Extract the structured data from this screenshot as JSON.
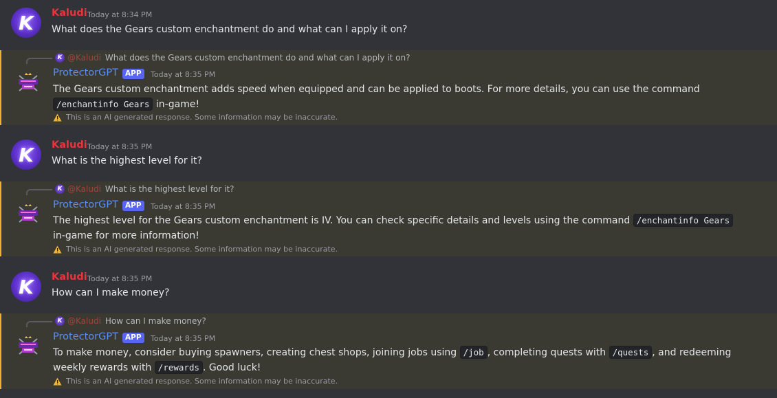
{
  "warning_text": "This is an AI generated response. Some information may be inaccurate.",
  "messages": [
    {
      "author": "Kaludi",
      "timestamp": "Today at 8:34 PM",
      "text": "What does the Gears custom enchantment do and what can I apply it on?"
    },
    {
      "reply_to_author": "@Kaludi",
      "reply_to_text": "What does the Gears custom enchantment do and what can I apply it on?",
      "author": "ProtectorGPT",
      "badge": "APP",
      "timestamp": "Today at 8:35 PM",
      "text_a": "The Gears custom enchantment adds speed when equipped and can be applied to boots. For more details, you can use the command",
      "code_a": "/enchantinfo Gears",
      "text_b": "in-game!"
    },
    {
      "author": "Kaludi",
      "timestamp": "Today at 8:35 PM",
      "text": "What is the highest level for it?"
    },
    {
      "reply_to_author": "@Kaludi",
      "reply_to_text": "What is the highest level for it?",
      "author": "ProtectorGPT",
      "badge": "APP",
      "timestamp": "Today at 8:35 PM",
      "text_a": "The highest level for the Gears custom enchantment is IV. You can check specific details and levels using the command",
      "code_a": "/enchantinfo Gears",
      "text_b": "in-game for more information!"
    },
    {
      "author": "Kaludi",
      "timestamp": "Today at 8:35 PM",
      "text": "How can I make money?"
    },
    {
      "reply_to_author": "@Kaludi",
      "reply_to_text": "How can I make money?",
      "author": "ProtectorGPT",
      "badge": "APP",
      "timestamp": "Today at 8:35 PM",
      "text_a": "To make money, consider buying spawners, creating chest shops, joining jobs using",
      "code_a": "/job",
      "text_b": ", completing quests with",
      "code_b": "/quests",
      "text_c": ", and redeeming weekly rewards with",
      "code_c": "/rewards",
      "text_d": ". Good luck!"
    }
  ],
  "icons": {
    "user_avatar": "kaludi-avatar-icon",
    "bot_avatar": "protectorcraft-logo-icon",
    "warning": "warning-icon"
  },
  "colors": {
    "background": "#313338",
    "highlight_background": "#3a3a33",
    "highlight_border": "#f0b232",
    "user_name": "#e8343c",
    "bot_name": "#5c8cf2",
    "app_badge": "#5865f2"
  }
}
